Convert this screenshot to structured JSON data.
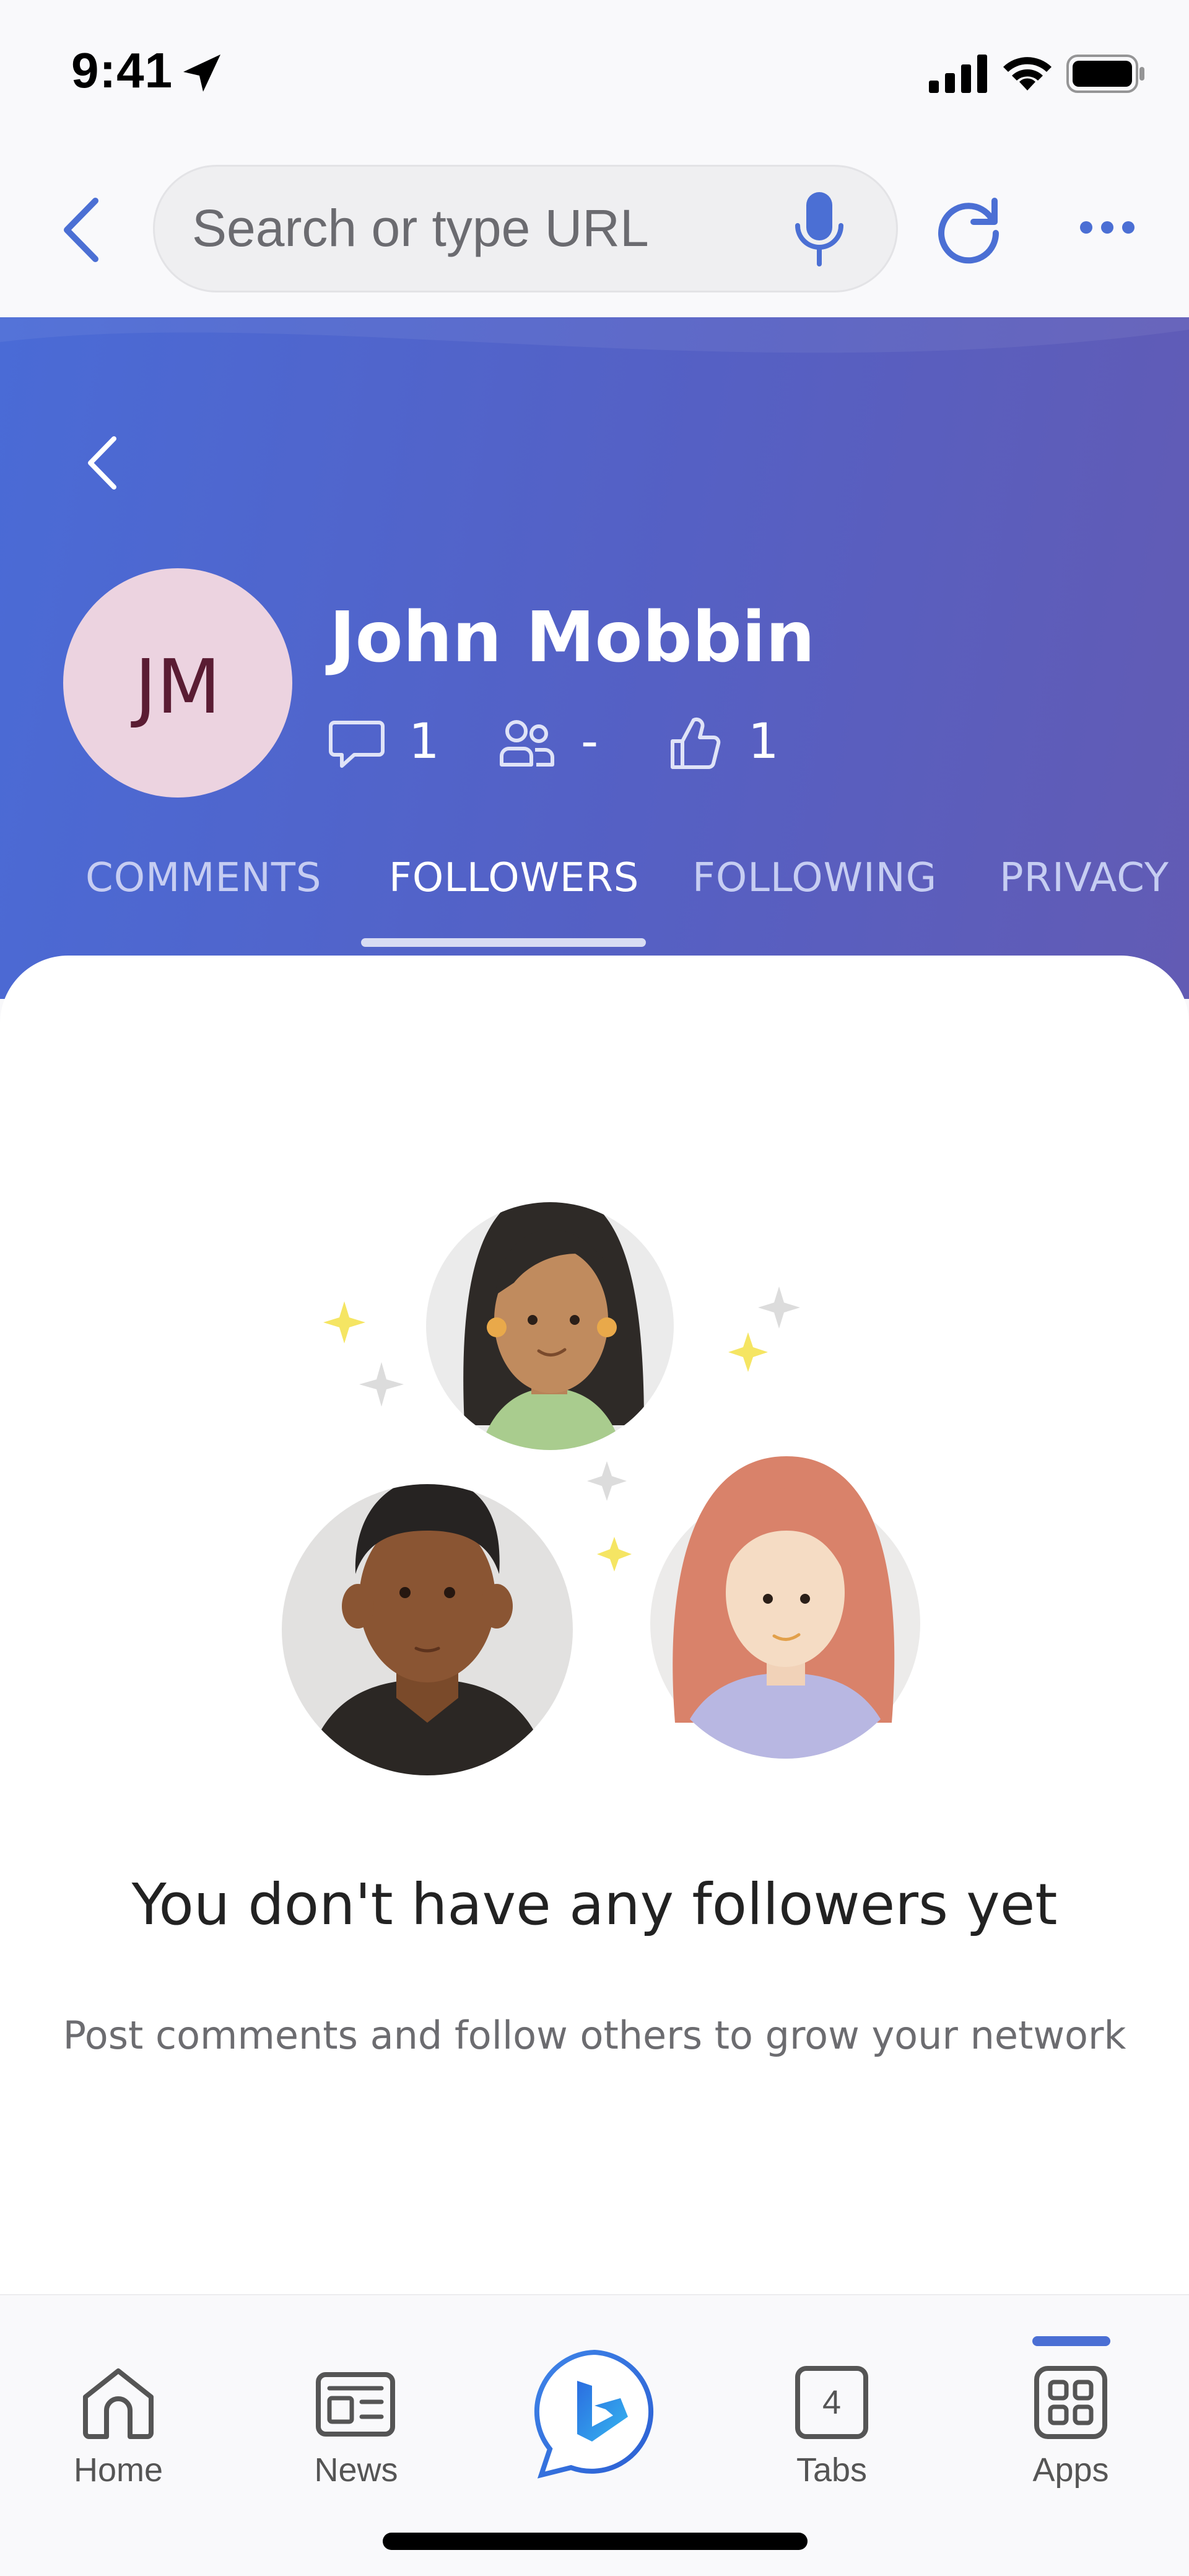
{
  "status_bar": {
    "time": "9:41"
  },
  "browser": {
    "search_placeholder": "Search or type URL"
  },
  "profile": {
    "initials": "JM",
    "name": "John Mobbin",
    "stats": {
      "comments": "1",
      "followers": "-",
      "likes": "1"
    },
    "avatar_color": "#ecd3e0",
    "header_gradient": [
      "#4a6bd6",
      "#625bb4"
    ]
  },
  "tabs": [
    {
      "label": "COMMENTS",
      "active": false
    },
    {
      "label": "FOLLOWERS",
      "active": true
    },
    {
      "label": "FOLLOWING",
      "active": false
    },
    {
      "label": "PRIVACY",
      "active": false
    }
  ],
  "empty_state": {
    "title": "You don't have any followers yet",
    "subtitle": "Post comments and follow others to grow your network"
  },
  "bottom_nav": [
    {
      "label": "Home",
      "icon": "home-icon"
    },
    {
      "label": "News",
      "icon": "news-icon"
    },
    {
      "label": "",
      "icon": "bing-chat-icon"
    },
    {
      "label": "Tabs",
      "icon": "tabs-icon",
      "count": "4"
    },
    {
      "label": "Apps",
      "icon": "apps-icon",
      "active": true
    }
  ],
  "colors": {
    "accent": "#4b6fd4",
    "text_primary": "#222222",
    "text_secondary": "#6c6c70"
  }
}
